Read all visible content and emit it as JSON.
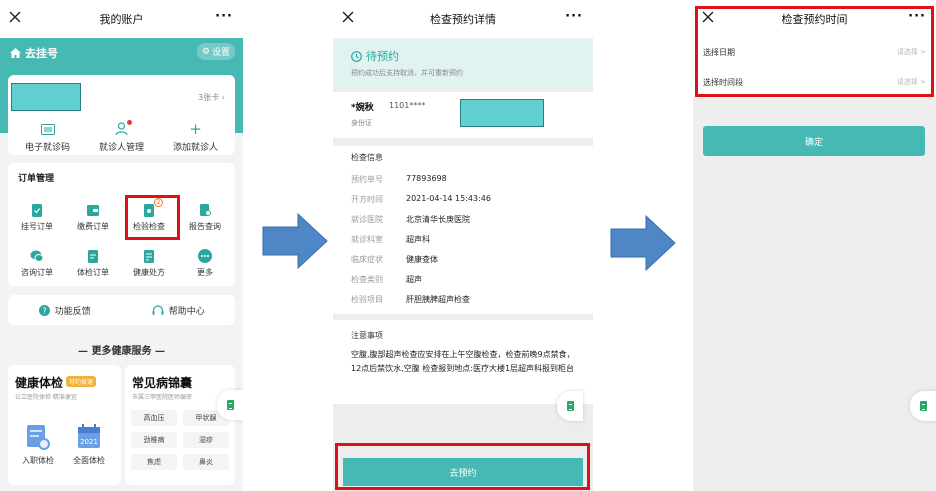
{
  "screen1": {
    "nav_title": "我的账户",
    "home_label": "去挂号",
    "settings_label": "设置",
    "card_count": "3张卡",
    "quick": [
      {
        "label": "电子就诊码",
        "icon": "barcode-icon"
      },
      {
        "label": "就诊人管理",
        "icon": "person-icon"
      },
      {
        "label": "添加就诊人",
        "icon": "plus-icon"
      }
    ],
    "orders_title": "订单管理",
    "orders": [
      {
        "label": "挂号订单",
        "icon": "clipboard-check-icon"
      },
      {
        "label": "缴费订单",
        "icon": "wallet-icon"
      },
      {
        "label": "检验检查",
        "icon": "test-report-icon",
        "badge": "2"
      },
      {
        "label": "报告查询",
        "icon": "report-search-icon"
      },
      {
        "label": "咨询订单",
        "icon": "chat-icon"
      },
      {
        "label": "体检订单",
        "icon": "checkup-icon"
      },
      {
        "label": "健康处方",
        "icon": "prescription-icon"
      },
      {
        "label": "更多",
        "icon": "more-icon"
      }
    ],
    "feedback_label": "功能反馈",
    "help_label": "帮助中心",
    "more_services": "— 更多健康服务 —",
    "health_check": {
      "title": "健康体检",
      "tag": "可约极速",
      "subtitle": "公立医院体检·精准便宜",
      "items": [
        {
          "label": "入职体检"
        },
        {
          "label": "全面体检",
          "calendar_text": "2021"
        }
      ]
    },
    "common_disease": {
      "title": "常见病锦囊",
      "subtitle": "市属三甲医院医师编审",
      "chips": [
        "高血压",
        "甲状腺",
        "劲椎病",
        "湿疹",
        "焦虑",
        "鼻炎"
      ]
    }
  },
  "screen2": {
    "nav_title": "检查预约详情",
    "status_title": "待预约",
    "status_desc": "预约成功后支持取消，并可重新预约",
    "patient_name": "*婉秋",
    "patient_id": "1101****",
    "id_type": "身份证",
    "info_title": "检查信息",
    "info_rows": [
      {
        "k": "预约单号",
        "v": "77893698"
      },
      {
        "k": "开方时间",
        "v": "2021-04-14 15:43:46"
      },
      {
        "k": "就诊医院",
        "v": "北京清华长庚医院"
      },
      {
        "k": "就诊科室",
        "v": "超声科"
      },
      {
        "k": "临床症状",
        "v": "健康查体"
      },
      {
        "k": "检查类别",
        "v": "超声"
      },
      {
        "k": "检验项目",
        "v": "肝胆胰脾超声检查"
      }
    ],
    "notes_title": "注意事项",
    "notes_body": "空腹,腹部超声检查应安排在上午空腹检查，检查前晚9点禁食，12点后禁饮水,空腹    检查报到地点:医疗大楼1层超声科报到柜台",
    "book_button": "去预约"
  },
  "screen3": {
    "nav_title": "检查预约时间",
    "pick_date": "选择日期",
    "pick_time": "选择时间段",
    "placeholder": "请选择 >",
    "confirm_button": "确定"
  },
  "colors": {
    "teal": "#47b9b4",
    "highlight_red": "#e0101a",
    "arrow_blue": "#4f86c6",
    "redaction": "#62cfd3"
  }
}
